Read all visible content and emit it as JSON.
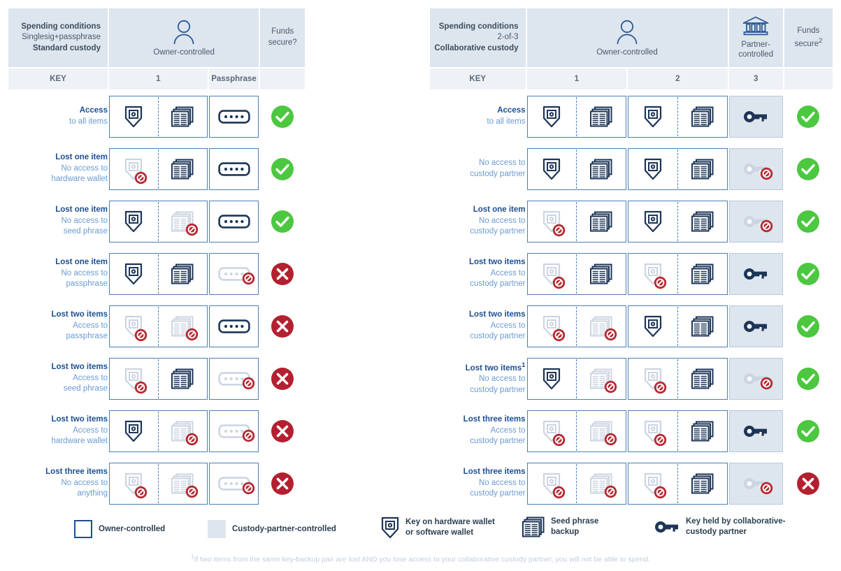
{
  "colors": {
    "header_band": "#dde5ef",
    "key_row": "#eef2f7",
    "box_border": "#4a7fb5",
    "partner_fill": "#dde5ef",
    "ink": "#1d3557",
    "label_bold": "#1d4f91",
    "label_sub": "#6b9bd2",
    "check_green": "#4cc740",
    "cross_red": "#b32030",
    "ban_red": "#b52a33",
    "dim_grey": "#ccd5e2"
  },
  "tables": [
    {
      "id": "left",
      "header": {
        "conditions_title": "Spending conditions",
        "conditions_scheme": "Singlesig+passphrase",
        "conditions_custody": "Standard custody",
        "owner_label": "Owner-controlled",
        "owner_icon": "person-icon",
        "funds_line1": "Funds",
        "funds_line2": "secure?",
        "funds_superscript": ""
      },
      "key_row": {
        "label": "KEY",
        "columns": [
          "1",
          "Passphrase"
        ]
      },
      "rows": [
        {
          "label": {
            "line1": "Access",
            "line2": "to all items",
            "line3": ""
          },
          "groups": [
            {
              "type": "pair",
              "left": {
                "icon": "hardware-wallet-icon",
                "state": "active"
              },
              "right": {
                "icon": "seed-phrase-icon",
                "state": "active"
              }
            },
            {
              "type": "single",
              "item": {
                "icon": "passphrase-icon",
                "state": "active"
              }
            }
          ],
          "result": "secure"
        },
        {
          "label": {
            "line1": "Lost one item",
            "line2": "No access to",
            "line3": "hardware wallet"
          },
          "groups": [
            {
              "type": "pair",
              "left": {
                "icon": "hardware-wallet-icon",
                "state": "lost"
              },
              "right": {
                "icon": "seed-phrase-icon",
                "state": "active"
              }
            },
            {
              "type": "single",
              "item": {
                "icon": "passphrase-icon",
                "state": "active"
              }
            }
          ],
          "result": "secure"
        },
        {
          "label": {
            "line1": "Lost one item",
            "line2": "No access to",
            "line3": "seed phrase"
          },
          "groups": [
            {
              "type": "pair",
              "left": {
                "icon": "hardware-wallet-icon",
                "state": "active"
              },
              "right": {
                "icon": "seed-phrase-icon",
                "state": "lost"
              }
            },
            {
              "type": "single",
              "item": {
                "icon": "passphrase-icon",
                "state": "active"
              }
            }
          ],
          "result": "secure"
        },
        {
          "label": {
            "line1": "Lost one item",
            "line2": "No access to",
            "line3": "passphrase"
          },
          "groups": [
            {
              "type": "pair",
              "left": {
                "icon": "hardware-wallet-icon",
                "state": "active"
              },
              "right": {
                "icon": "seed-phrase-icon",
                "state": "active"
              }
            },
            {
              "type": "single",
              "item": {
                "icon": "passphrase-icon",
                "state": "lost"
              }
            }
          ],
          "result": "insecure"
        },
        {
          "label": {
            "line1": "Lost two items",
            "line2": "Access to",
            "line3": "passphrase"
          },
          "groups": [
            {
              "type": "pair",
              "left": {
                "icon": "hardware-wallet-icon",
                "state": "lost"
              },
              "right": {
                "icon": "seed-phrase-icon",
                "state": "lost"
              }
            },
            {
              "type": "single",
              "item": {
                "icon": "passphrase-icon",
                "state": "active"
              }
            }
          ],
          "result": "insecure"
        },
        {
          "label": {
            "line1": "Lost two items",
            "line2": "Access to",
            "line3": "seed phrase"
          },
          "groups": [
            {
              "type": "pair",
              "left": {
                "icon": "hardware-wallet-icon",
                "state": "lost"
              },
              "right": {
                "icon": "seed-phrase-icon",
                "state": "active"
              }
            },
            {
              "type": "single",
              "item": {
                "icon": "passphrase-icon",
                "state": "lost"
              }
            }
          ],
          "result": "insecure"
        },
        {
          "label": {
            "line1": "Lost two items",
            "line2": "Access to",
            "line3": "hardware wallet"
          },
          "groups": [
            {
              "type": "pair",
              "left": {
                "icon": "hardware-wallet-icon",
                "state": "active"
              },
              "right": {
                "icon": "seed-phrase-icon",
                "state": "lost"
              }
            },
            {
              "type": "single",
              "item": {
                "icon": "passphrase-icon",
                "state": "lost"
              }
            }
          ],
          "result": "insecure"
        },
        {
          "label": {
            "line1": "Lost three items",
            "line2": "No access to",
            "line3": "anything"
          },
          "groups": [
            {
              "type": "pair",
              "left": {
                "icon": "hardware-wallet-icon",
                "state": "lost"
              },
              "right": {
                "icon": "seed-phrase-icon",
                "state": "lost"
              }
            },
            {
              "type": "single",
              "item": {
                "icon": "passphrase-icon",
                "state": "lost"
              }
            }
          ],
          "result": "insecure"
        }
      ]
    },
    {
      "id": "right",
      "header": {
        "conditions_title": "Spending conditions",
        "conditions_scheme": "2-of-3",
        "conditions_custody": "Collaborative custody",
        "owner_label": "Owner-controlled",
        "owner_icon": "person-icon",
        "partner_line1": "Partner-",
        "partner_line2": "controlled",
        "partner_icon": "bank-icon",
        "funds_line1": "Funds",
        "funds_line2": "secure",
        "funds_superscript": "2"
      },
      "key_row": {
        "label": "KEY",
        "columns": [
          "1",
          "2",
          "3"
        ]
      },
      "rows": [
        {
          "label": {
            "line1": "Access",
            "line2": "to all items",
            "line3": ""
          },
          "groups": [
            {
              "type": "pair",
              "left": {
                "icon": "hardware-wallet-icon",
                "state": "active"
              },
              "right": {
                "icon": "seed-phrase-icon",
                "state": "active"
              }
            },
            {
              "type": "pair",
              "left": {
                "icon": "hardware-wallet-icon",
                "state": "active"
              },
              "right": {
                "icon": "seed-phrase-icon",
                "state": "active"
              }
            },
            {
              "type": "partner",
              "item": {
                "icon": "partner-key-icon",
                "state": "active"
              }
            }
          ],
          "result": "secure"
        },
        {
          "label": {
            "line1": "",
            "line2": "No access to",
            "line3": "custody partner"
          },
          "groups": [
            {
              "type": "pair",
              "left": {
                "icon": "hardware-wallet-icon",
                "state": "active"
              },
              "right": {
                "icon": "seed-phrase-icon",
                "state": "active"
              }
            },
            {
              "type": "pair",
              "left": {
                "icon": "hardware-wallet-icon",
                "state": "active"
              },
              "right": {
                "icon": "seed-phrase-icon",
                "state": "active"
              }
            },
            {
              "type": "partner",
              "item": {
                "icon": "partner-key-icon",
                "state": "lost"
              }
            }
          ],
          "result": "secure"
        },
        {
          "label": {
            "line1": "Lost one item",
            "line2": "No access to",
            "line3": "custody partner"
          },
          "groups": [
            {
              "type": "pair",
              "left": {
                "icon": "hardware-wallet-icon",
                "state": "lost"
              },
              "right": {
                "icon": "seed-phrase-icon",
                "state": "active"
              }
            },
            {
              "type": "pair",
              "left": {
                "icon": "hardware-wallet-icon",
                "state": "active"
              },
              "right": {
                "icon": "seed-phrase-icon",
                "state": "active"
              }
            },
            {
              "type": "partner",
              "item": {
                "icon": "partner-key-icon",
                "state": "lost"
              }
            }
          ],
          "result": "secure"
        },
        {
          "label": {
            "line1": "Lost two items",
            "line2": "Access to",
            "line3": "custody partner"
          },
          "groups": [
            {
              "type": "pair",
              "left": {
                "icon": "hardware-wallet-icon",
                "state": "lost"
              },
              "right": {
                "icon": "seed-phrase-icon",
                "state": "active"
              }
            },
            {
              "type": "pair",
              "left": {
                "icon": "hardware-wallet-icon",
                "state": "lost"
              },
              "right": {
                "icon": "seed-phrase-icon",
                "state": "active"
              }
            },
            {
              "type": "partner",
              "item": {
                "icon": "partner-key-icon",
                "state": "active"
              }
            }
          ],
          "result": "secure"
        },
        {
          "label": {
            "line1": "Lost two items",
            "line2": "Access to",
            "line3": "custody partner"
          },
          "groups": [
            {
              "type": "pair",
              "left": {
                "icon": "hardware-wallet-icon",
                "state": "lost"
              },
              "right": {
                "icon": "seed-phrase-icon",
                "state": "lost"
              }
            },
            {
              "type": "pair",
              "left": {
                "icon": "hardware-wallet-icon",
                "state": "active"
              },
              "right": {
                "icon": "seed-phrase-icon",
                "state": "active"
              }
            },
            {
              "type": "partner",
              "item": {
                "icon": "partner-key-icon",
                "state": "active"
              }
            }
          ],
          "result": "secure"
        },
        {
          "label": {
            "line1": "Lost two items",
            "line1_sup": "1",
            "line2": "No access to",
            "line3": "custody partner"
          },
          "groups": [
            {
              "type": "pair",
              "left": {
                "icon": "hardware-wallet-icon",
                "state": "active"
              },
              "right": {
                "icon": "seed-phrase-icon",
                "state": "lost"
              }
            },
            {
              "type": "pair",
              "left": {
                "icon": "hardware-wallet-icon",
                "state": "lost"
              },
              "right": {
                "icon": "seed-phrase-icon",
                "state": "active"
              }
            },
            {
              "type": "partner",
              "item": {
                "icon": "partner-key-icon",
                "state": "lost"
              }
            }
          ],
          "result": "secure"
        },
        {
          "label": {
            "line1": "Lost three items",
            "line2": "Access to",
            "line3": "custody partner"
          },
          "groups": [
            {
              "type": "pair",
              "left": {
                "icon": "hardware-wallet-icon",
                "state": "lost"
              },
              "right": {
                "icon": "seed-phrase-icon",
                "state": "lost"
              }
            },
            {
              "type": "pair",
              "left": {
                "icon": "hardware-wallet-icon",
                "state": "lost"
              },
              "right": {
                "icon": "seed-phrase-icon",
                "state": "active"
              }
            },
            {
              "type": "partner",
              "item": {
                "icon": "partner-key-icon",
                "state": "active"
              }
            }
          ],
          "result": "secure"
        },
        {
          "label": {
            "line1": "Lost three items",
            "line2": "No access to",
            "line3": "custody partner"
          },
          "groups": [
            {
              "type": "pair",
              "left": {
                "icon": "hardware-wallet-icon",
                "state": "lost"
              },
              "right": {
                "icon": "seed-phrase-icon",
                "state": "lost"
              }
            },
            {
              "type": "pair",
              "left": {
                "icon": "hardware-wallet-icon",
                "state": "lost"
              },
              "right": {
                "icon": "seed-phrase-icon",
                "state": "active"
              }
            },
            {
              "type": "partner",
              "item": {
                "icon": "partner-key-icon",
                "state": "lost"
              }
            }
          ],
          "result": "insecure"
        }
      ]
    }
  ],
  "legend": [
    {
      "swatch": "outline-box",
      "icon": "",
      "lines": [
        "Owner-controlled"
      ]
    },
    {
      "swatch": "filled-box",
      "icon": "",
      "lines": [
        "Custody-partner-controlled"
      ]
    },
    {
      "swatch": "",
      "icon": "hardware-wallet-icon",
      "lines": [
        "Key on hardware wallet",
        "or software wallet"
      ]
    },
    {
      "swatch": "",
      "icon": "seed-phrase-icon",
      "lines": [
        "Seed phrase",
        "backup"
      ]
    },
    {
      "swatch": "",
      "icon": "partner-key-icon",
      "lines": [
        "Key held by collaborative-",
        "custody partner"
      ]
    }
  ],
  "footnote": {
    "marker": "1",
    "text": "If two items from the same key-backup pair are lost AND you lose access to your collaborative custody partner, you will not be able to spend."
  }
}
